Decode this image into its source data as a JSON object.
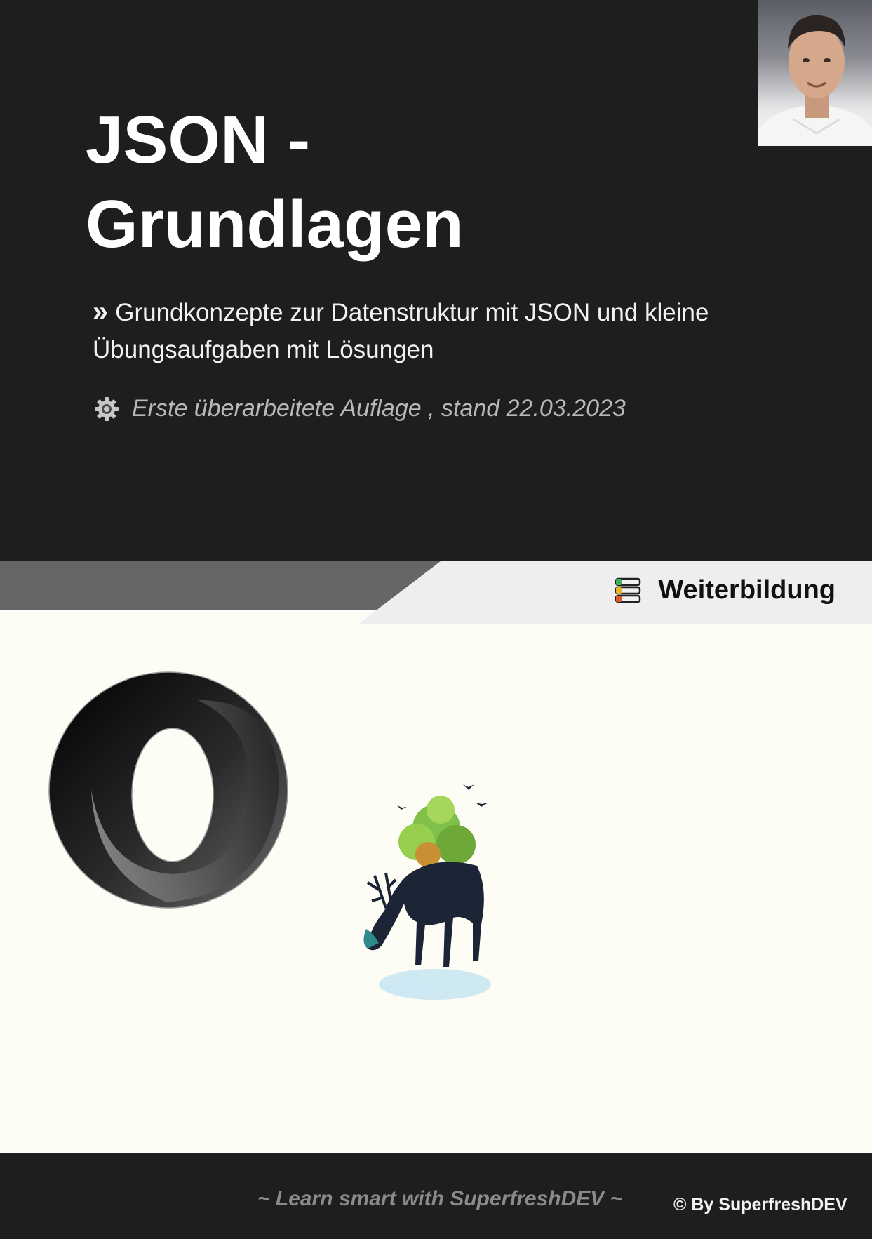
{
  "header": {
    "title_line1": "JSON -",
    "title_line2": "Grundlagen",
    "subtitle_mark": "»",
    "subtitle": "Grundkonzepte zur Datenstruktur mit JSON und kleine Übungsaufgaben mit Lösungen",
    "edition": "Erste überarbeitete Auflage , stand 22.03.2023",
    "edition_icon": "gear-icon",
    "author_photo": "author-portrait"
  },
  "band": {
    "category": "Weiterbildung",
    "category_icon": "books-icon",
    "dark_color": "#666666",
    "light_color": "#eeeeee"
  },
  "illustrations": {
    "logo": "json-logo",
    "image": "deer-drinking-illustration"
  },
  "footer": {
    "slogan": "~ Learn smart with SuperfreshDEV ~",
    "copyright": "© By SuperfreshDEV"
  },
  "colors": {
    "background_dark": "#1e1e1e",
    "page_background": "#fdfdf5",
    "edition_text": "#b8b8b8"
  }
}
